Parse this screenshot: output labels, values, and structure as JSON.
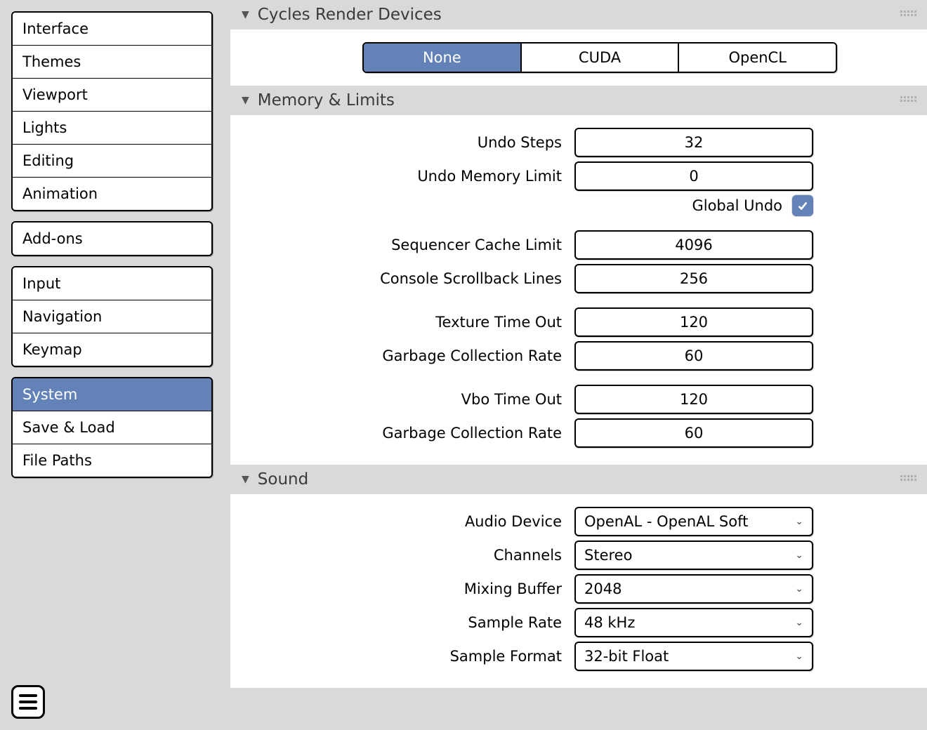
{
  "sidebar": {
    "groups": [
      {
        "items": [
          "Interface",
          "Themes",
          "Viewport",
          "Lights",
          "Editing",
          "Animation"
        ]
      },
      {
        "items": [
          "Add-ons"
        ]
      },
      {
        "items": [
          "Input",
          "Navigation",
          "Keymap"
        ]
      },
      {
        "items": [
          "System",
          "Save & Load",
          "File Paths"
        ]
      }
    ],
    "active": "System"
  },
  "sections": {
    "cycles": {
      "title": "Cycles Render Devices",
      "options": [
        "None",
        "CUDA",
        "OpenCL"
      ],
      "selected": "None"
    },
    "memory": {
      "title": "Memory & Limits",
      "undo_steps_label": "Undo Steps",
      "undo_steps": "32",
      "undo_mem_label": "Undo Memory Limit",
      "undo_mem": "0",
      "global_undo_label": "Global Undo",
      "global_undo": true,
      "seq_cache_label": "Sequencer Cache Limit",
      "seq_cache": "4096",
      "console_lines_label": "Console Scrollback Lines",
      "console_lines": "256",
      "tex_timeout_label": "Texture Time Out",
      "tex_timeout": "120",
      "tex_gc_label": "Garbage Collection Rate",
      "tex_gc": "60",
      "vbo_timeout_label": "Vbo Time Out",
      "vbo_timeout": "120",
      "vbo_gc_label": "Garbage Collection Rate",
      "vbo_gc": "60"
    },
    "sound": {
      "title": "Sound",
      "audio_device_label": "Audio Device",
      "audio_device": "OpenAL - OpenAL Soft",
      "channels_label": "Channels",
      "channels": "Stereo",
      "mixing_buffer_label": "Mixing Buffer",
      "mixing_buffer": "2048",
      "sample_rate_label": "Sample Rate",
      "sample_rate": "48 kHz",
      "sample_format_label": "Sample Format",
      "sample_format": "32-bit Float"
    }
  }
}
